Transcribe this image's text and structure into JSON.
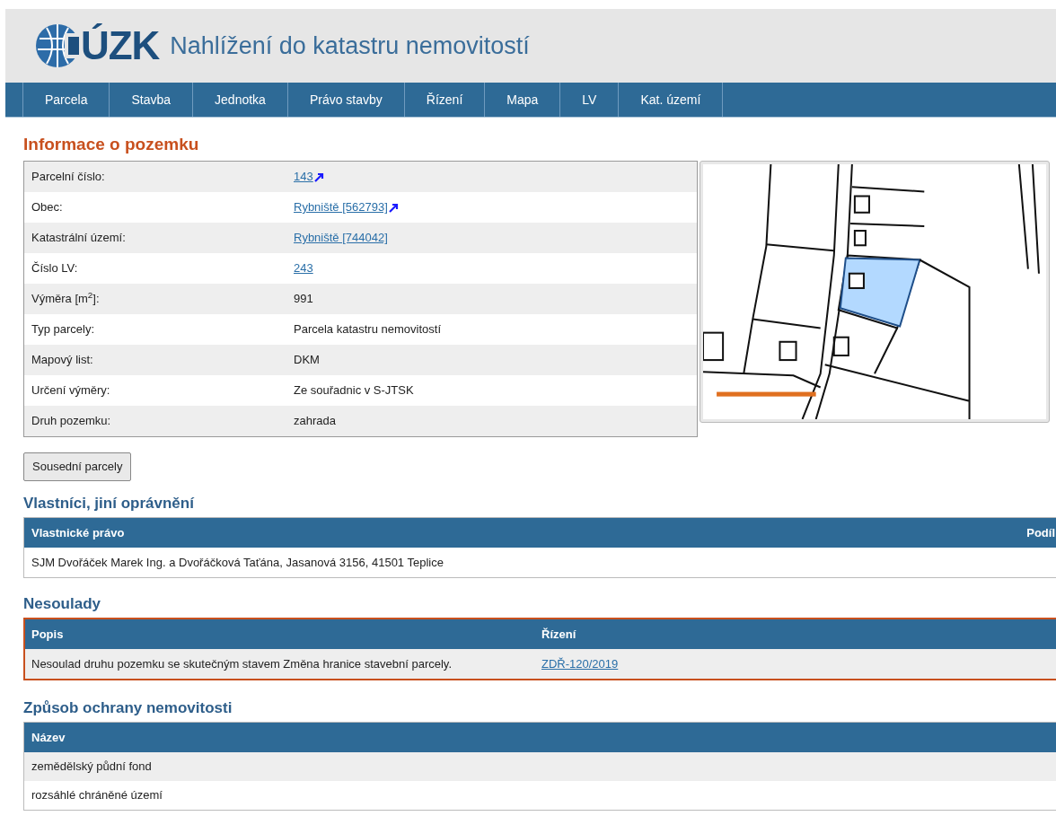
{
  "header": {
    "logo": "ÚZK",
    "title": "Nahlížení do katastru nemovitostí"
  },
  "nav": [
    "Parcela",
    "Stavba",
    "Jednotka",
    "Právo stavby",
    "Řízení",
    "Mapa",
    "LV",
    "Kat. území"
  ],
  "info": {
    "heading": "Informace o pozemku",
    "rows": [
      {
        "label": "Parcelní číslo:",
        "value": "143",
        "kind": "link",
        "external": true
      },
      {
        "label": "Obec:",
        "value": "Rybniště [562793]",
        "kind": "link",
        "external": true
      },
      {
        "label": "Katastrální území:",
        "value": "Rybniště [744042]",
        "kind": "link",
        "external": false
      },
      {
        "label": "Číslo LV:",
        "value": "243",
        "kind": "link",
        "external": false
      },
      {
        "label": "Výměra [m$^{2}$]:",
        "value": "991",
        "kind": "text"
      },
      {
        "label": "Typ parcely:",
        "value": "Parcela katastru nemovitostí",
        "kind": "text"
      },
      {
        "label": "Mapový list:",
        "value": "DKM",
        "kind": "text"
      },
      {
        "label": "Určení výměry:",
        "value": "Ze souřadnic v S-JTSK",
        "kind": "text"
      },
      {
        "label": "Druh pozemku:",
        "value": "zahrada",
        "kind": "text"
      }
    ]
  },
  "neighbours_button": "Sousední parcely",
  "owners": {
    "heading": "Vlastníci, jiní oprávnění",
    "columns": [
      "Vlastnické právo",
      "Podíl"
    ],
    "rows": [
      [
        "SJM Dvořáček Marek Ing. a Dvořáčková Taťána, Jasanová 3156, 41501 Teplice"
      ]
    ]
  },
  "discrepancies": {
    "heading": "Nesoulady",
    "columns": [
      "Popis",
      "Řízení"
    ],
    "rows": [
      {
        "description": "Nesoulad druhu pozemku se skutečným stavem Změna hranice stavební parcely.",
        "proceeding": "ZDŘ-120/2019"
      }
    ]
  },
  "protection": {
    "heading": "Způsob ochrany nemovitosti",
    "columns": [
      "Název"
    ],
    "rows": [
      "zemědělský půdní fond",
      "rozsáhlé chráněné území"
    ]
  }
}
